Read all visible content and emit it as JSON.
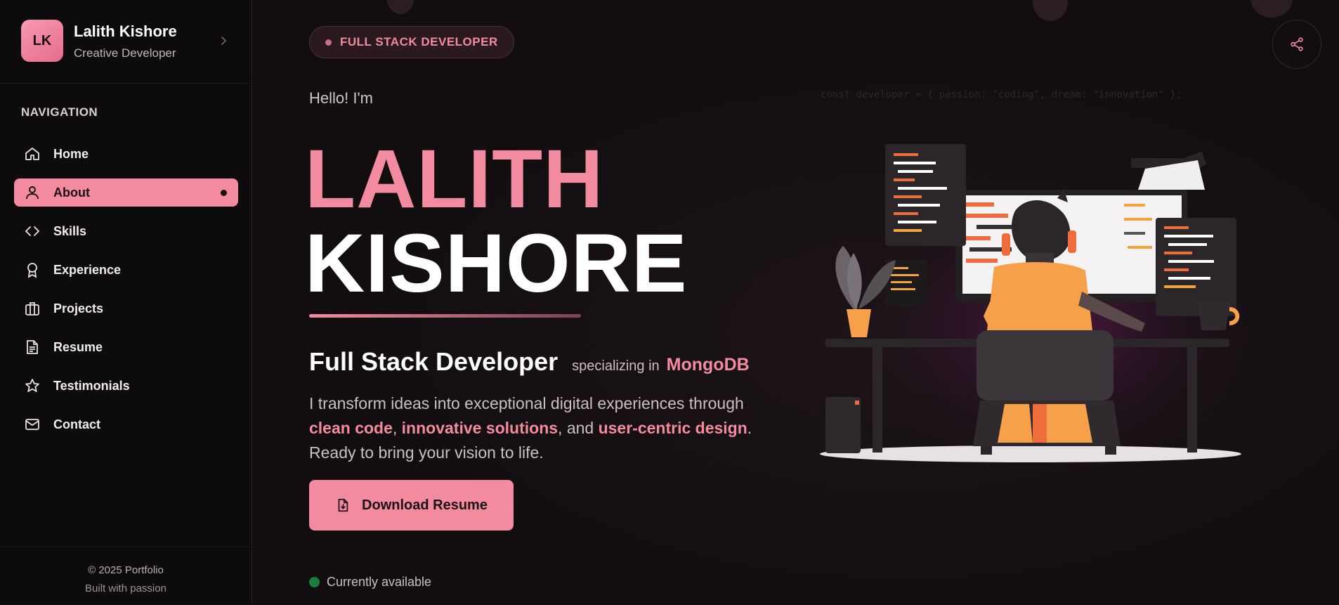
{
  "brand": {
    "initials": "LK",
    "name": "Lalith Kishore",
    "role": "Creative Developer"
  },
  "nav": {
    "heading": "NAVIGATION",
    "items": [
      {
        "label": "Home",
        "icon": "home-icon"
      },
      {
        "label": "About",
        "icon": "user-icon",
        "active": true
      },
      {
        "label": "Skills",
        "icon": "code-icon"
      },
      {
        "label": "Experience",
        "icon": "award-icon"
      },
      {
        "label": "Projects",
        "icon": "briefcase-icon"
      },
      {
        "label": "Resume",
        "icon": "document-icon"
      },
      {
        "label": "Testimonials",
        "icon": "star-icon"
      },
      {
        "label": "Contact",
        "icon": "mail-icon"
      }
    ]
  },
  "footer": {
    "copyright": "© 2025 Portfolio",
    "tagline": "Built with passion"
  },
  "hero": {
    "badge": "FULL STACK DEVELOPER",
    "greeting": "Hello! I'm",
    "first_name": "LALITH",
    "last_name": "KISHORE",
    "title": "Full Stack Developer",
    "specializing": "specializing in",
    "tech": "MongoDB",
    "desc_1": "I transform ideas into exceptional digital experiences through ",
    "desc_hl1": "clean code",
    "desc_2": ", ",
    "desc_hl2": "innovative solutions",
    "desc_3": ", and ",
    "desc_hl3": "user-centric design",
    "desc_4": ". Ready to bring your vision to life.",
    "download_label": "Download Resume",
    "status": "Currently available",
    "code_snippet": "const developer = { passion: \"coding\", dream: \"innovation\" };"
  },
  "colors": {
    "accent": "#f38ba0",
    "background": "#120e10",
    "sidebar": "#0d0b0c",
    "status_green": "#1f7a3d"
  },
  "icons": {
    "share": "share-icon",
    "chevron": "chevron-right-icon",
    "download": "file-download-icon"
  }
}
